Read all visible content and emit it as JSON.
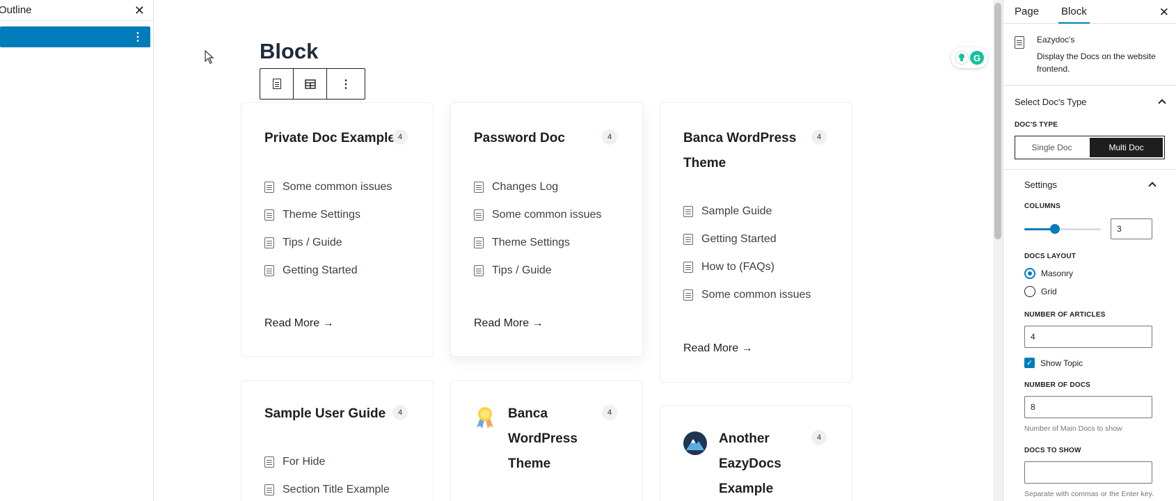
{
  "outline": {
    "title": "Outline",
    "close_glyph": "✕",
    "menu_glyph": "⋮"
  },
  "canvas": {
    "block_title": "Block",
    "toolbar": {
      "more_glyph": "⋮"
    },
    "grammarly": {
      "g_label": "G"
    },
    "cards": [
      {
        "title": "Private Doc Example",
        "count": "4",
        "items": [
          "Some common issues",
          "Theme Settings",
          "Tips / Guide",
          "Getting Started"
        ],
        "read_more": "Read More →"
      },
      {
        "title": "Password Doc",
        "count": "4",
        "items": [
          "Changes Log",
          "Some common issues",
          "Theme Settings",
          "Tips / Guide"
        ],
        "read_more": "Read More →"
      },
      {
        "title_line1": "Banca WordPress",
        "title_line2": "Theme",
        "count": "4",
        "items": [
          "Sample Guide",
          "Getting Started",
          "How to (FAQs)",
          "Some common issues"
        ],
        "read_more": "Read More →"
      },
      {
        "title": "Sample User Guide",
        "count": "4",
        "items": [
          "For Hide",
          "Section Title Example"
        ]
      },
      {
        "title_line1": "Banca",
        "title_line2": "WordPress",
        "title_line3": "Theme",
        "count": "4",
        "icon": "award-icon"
      },
      {
        "title_line1": "Another",
        "title_line2": "EazyDocs",
        "title_line3": "Example",
        "count": "4",
        "icon": "mountain-icon"
      }
    ]
  },
  "sidebar": {
    "tabs": [
      "Page",
      "Block"
    ],
    "active_tab": "Block",
    "close_glyph": "✕",
    "block_name": "Eazydoc's",
    "block_desc": "Display the Docs on the website frontend.",
    "select_type_panel": "Select Doc's Type",
    "docs_type_label": "DOC'S TYPE",
    "docs_type_options": [
      "Single Doc",
      "Multi Doc"
    ],
    "docs_type_selected": "Multi Doc",
    "settings_panel": "Settings",
    "columns_label": "COLUMNS",
    "columns_value": "3",
    "columns_fraction": 0.4,
    "layout_label": "DOCS LAYOUT",
    "layout_options": [
      "Masonry",
      "Grid"
    ],
    "layout_selected": "Masonry",
    "articles_label": "NUMBER OF ARTICLES",
    "articles_value": "4",
    "show_topic_label": "Show Topic",
    "show_topic_checked": true,
    "docs_count_label": "NUMBER OF DOCS",
    "docs_count_value": "8",
    "docs_count_help": "Number of Main Docs to show",
    "docs_to_show_label": "DOCS TO SHOW",
    "docs_to_show_value": "",
    "docs_to_show_help": "Separate with commas or the Enter key."
  },
  "colors": {
    "accent": "#007cba",
    "dark": "#1e1e1e",
    "grammarly": "#15c39a"
  }
}
